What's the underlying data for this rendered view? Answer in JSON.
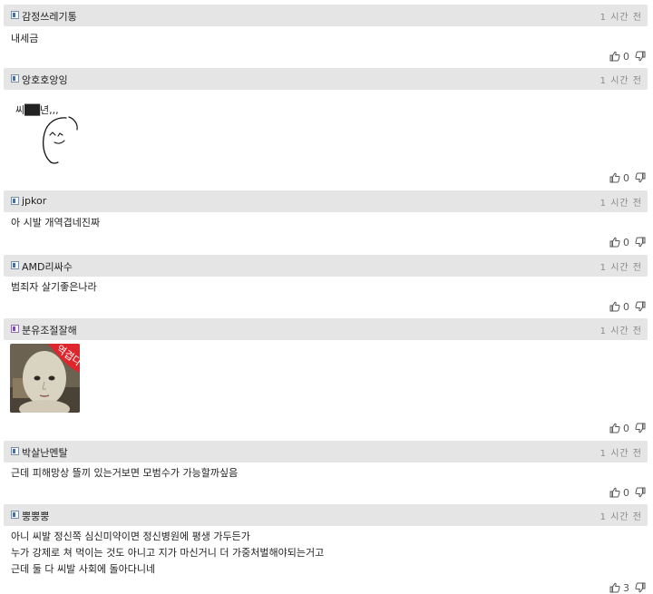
{
  "comments": [
    {
      "nickname": "감정쓰레기통",
      "time": "1 시간 전",
      "body": [
        "내세금"
      ],
      "likes": "0"
    },
    {
      "nickname": "앙호호앙잉",
      "time": "1 시간 전",
      "body": [
        "씨██년,,,"
      ],
      "likes": "0"
    },
    {
      "nickname": "jpkor",
      "time": "1 시간 전",
      "body": [
        "아 시발 개역겹네진짜"
      ],
      "likes": "0"
    },
    {
      "nickname": "AMD리싸수",
      "time": "1 시간 전",
      "body": [
        "범죄자 살기좋은나라"
      ],
      "likes": "0"
    },
    {
      "nickname": "분유조절잘해",
      "time": "1 시간 전",
      "sticker_text": "역겹다",
      "likes": "0"
    },
    {
      "nickname": "박살난멘탈",
      "time": "1 시간 전",
      "body": [
        "근데 피해망상 뜰끼 있는거보면 모범수가 가능할까싶음"
      ],
      "likes": "0"
    },
    {
      "nickname": "뿡뿡뿡",
      "time": "1 시간 전",
      "body": [
        "아니 씨발 정신쪽 심신미약이면 정신병원에 평생 가두든가",
        "누가 강제로 쳐 먹이는 것도 아니고 지가 마신거니 더 가중처벌해야되는거고",
        "근데 둘 다 씨발 사회에 돌아다니네"
      ],
      "likes": "3"
    }
  ],
  "icons": {
    "level": "level-icon",
    "like": "thumbs-up-icon",
    "dislike": "thumbs-down-icon",
    "drawing": "doodle-face-drawing",
    "sticker": "baby-face-sticker"
  },
  "colors": {
    "header_bg": "#e5e5e5",
    "time": "#8a8a8a",
    "sticker_badge": "#e0262d"
  }
}
